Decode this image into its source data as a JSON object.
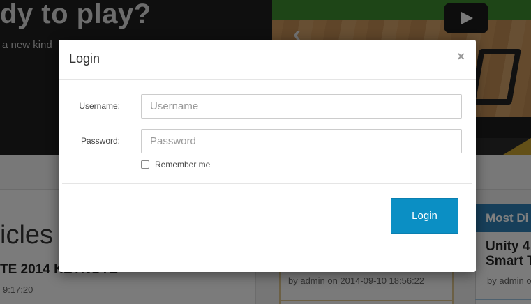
{
  "hero": {
    "heading": "dy to play?",
    "subtitle": "a new kind"
  },
  "video": {
    "play_icon": "play-icon",
    "prev_icon": "chevron-left-icon"
  },
  "articles": {
    "heading": "icles",
    "title": "TE 2014 KEYNOTE",
    "meta": "9:17:20"
  },
  "middle": {
    "meta": "by admin on 2014-09-10 18:56:22"
  },
  "sidebar": {
    "tab_label": "Most Di",
    "title_line1": "Unity 4",
    "title_line2": "Smart T",
    "meta": "by admin o"
  },
  "modal": {
    "title": "Login",
    "close_symbol": "×",
    "username_label": "Username:",
    "username_placeholder": "Username",
    "username_value": "",
    "password_label": "Password:",
    "password_placeholder": "Password",
    "password_value": "",
    "remember_label": "Remember me",
    "remember_checked": false,
    "submit_label": "Login"
  },
  "colors": {
    "accent": "#0b8fc4",
    "tab_blue": "#2e7fb5",
    "hero_bg": "#1f1f1f"
  }
}
